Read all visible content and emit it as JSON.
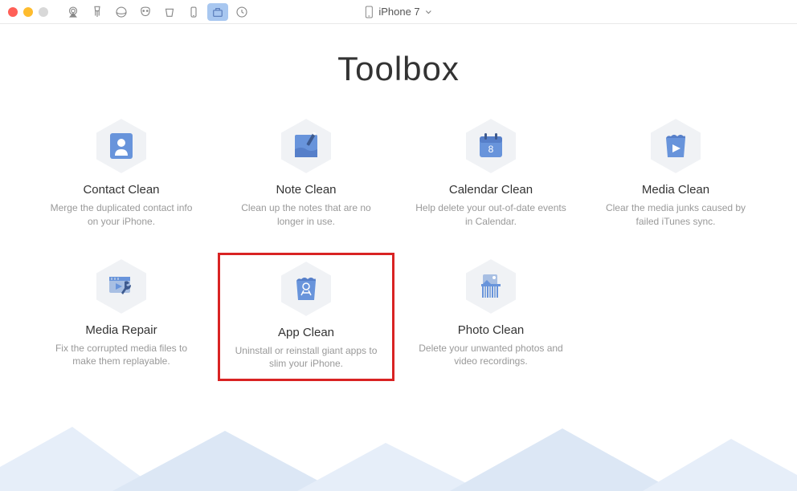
{
  "device": {
    "name": "iPhone 7"
  },
  "page": {
    "title": "Toolbox"
  },
  "tools": {
    "contact_clean": {
      "title": "Contact Clean",
      "desc": "Merge the duplicated contact info on your iPhone."
    },
    "note_clean": {
      "title": "Note Clean",
      "desc": "Clean up the notes that are no longer in use."
    },
    "calendar_clean": {
      "title": "Calendar Clean",
      "desc": "Help delete your out-of-date events in Calendar.",
      "badge": "8"
    },
    "media_clean": {
      "title": "Media Clean",
      "desc": "Clear the media junks caused by failed iTunes sync."
    },
    "media_repair": {
      "title": "Media Repair",
      "desc": "Fix the corrupted media files to make them replayable."
    },
    "app_clean": {
      "title": "App Clean",
      "desc": "Uninstall or reinstall giant apps to slim your iPhone."
    },
    "photo_clean": {
      "title": "Photo Clean",
      "desc": "Delete your unwanted photos and video recordings."
    }
  },
  "colors": {
    "accent": "#5c8fe0",
    "highlight": "#d92323",
    "hex_bg": "#f0f2f5"
  }
}
